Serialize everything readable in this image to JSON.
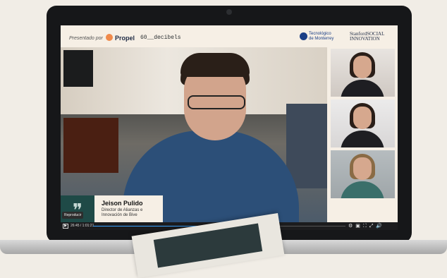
{
  "sponsor_bar": {
    "presented_by": "Presentado por",
    "propel": "Propel",
    "decibels": "60__decibels",
    "tec_line1": "Tecnológico",
    "tec_line2": "de Monterrey",
    "ssir_line1": "StanfordSOCIAL",
    "ssir_line2": "INNOVATION"
  },
  "speaker": {
    "quote_mark": "❞",
    "name": "Jeison Pulido",
    "role": "Director de Alianzas e Innovación de Bive"
  },
  "player": {
    "tooltip": "Reproducir",
    "time": "26:45 / 1:01:21",
    "progress": 0.436,
    "icons": [
      "settings-icon",
      "picture-in-picture-icon",
      "fullscreen-icon",
      "expand-icon",
      "volume-icon"
    ]
  },
  "colors": {
    "accent": "#3aa3ff",
    "quote_box": "#1f4a47"
  }
}
